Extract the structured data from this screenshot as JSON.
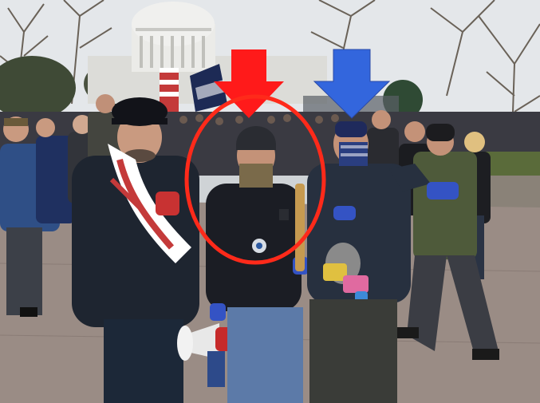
{
  "photo": {
    "annotations": {
      "red_arrow_color": "#ff1a1a",
      "blue_arrow_color": "#3366dd",
      "circle_color": "#ff2a1a"
    },
    "palette": {
      "sky": "#e4e7ea",
      "capitol": "#e9e9e6",
      "pavement": "#9a8c85",
      "crowd_dark": "#26272c",
      "jacket_blue": "#2f4f86",
      "olive": "#4e5a3a"
    }
  }
}
